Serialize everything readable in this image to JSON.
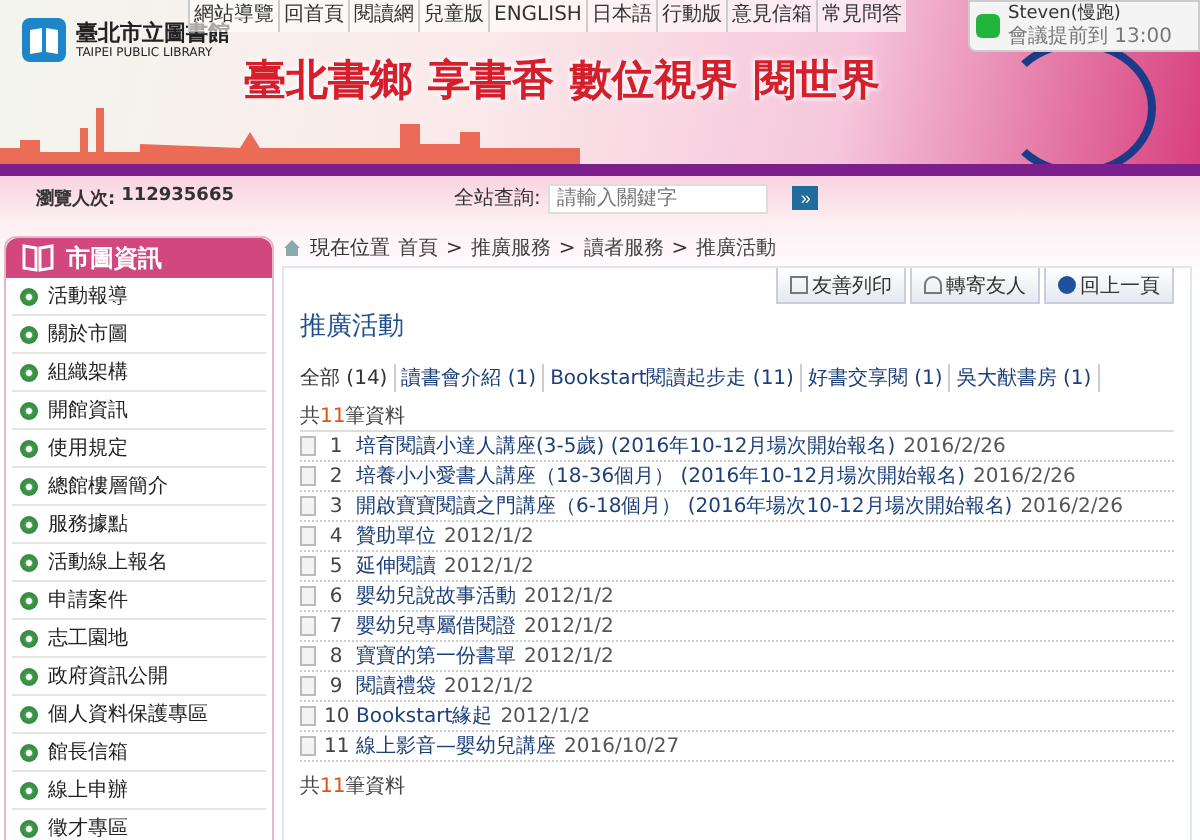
{
  "top_nav": [
    "網站導覽",
    "回首頁",
    "閱讀網",
    "兒童版",
    "ENGLISH",
    "日本語",
    "行動版",
    "意見信箱",
    "常見問答"
  ],
  "logo": {
    "name": "臺北市立圖書館",
    "subtitle": "TAIPEI PUBLIC LIBRARY"
  },
  "banner": {
    "slogans": [
      "臺北書鄉",
      "享書香",
      "數位視界",
      "閱世界"
    ]
  },
  "notification": {
    "sender": "Steven(慢跑)",
    "message": "會議提前到 13:00"
  },
  "visitors": {
    "label": "瀏覽人次:",
    "count": "112935665"
  },
  "search": {
    "label": "全站查詢:",
    "placeholder": "請輸入關鍵字",
    "button": "»"
  },
  "sidebar": {
    "title": "市圖資訊",
    "items": [
      "活動報導",
      "關於市圖",
      "組織架構",
      "開館資訊",
      "使用規定",
      "總館樓層簡介",
      "服務據點",
      "活動線上報名",
      "申請案件",
      "志工園地",
      "政府資訊公開",
      "個人資料保護專區",
      "館長信箱",
      "線上申辦",
      "徵才專區"
    ]
  },
  "breadcrumb": {
    "label": "現在位置",
    "path": [
      {
        "kind": "link",
        "text": "首頁"
      },
      {
        "kind": "separator",
        "text": ">"
      },
      {
        "kind": "link",
        "text": "推廣服務"
      },
      {
        "kind": "separator",
        "text": ">"
      },
      {
        "kind": "link",
        "text": "讀者服務"
      },
      {
        "kind": "separator",
        "text": ">"
      },
      {
        "kind": "link",
        "text": "推廣活動"
      }
    ]
  },
  "actions": [
    {
      "kind": "print",
      "label": "友善列印"
    },
    {
      "kind": "forward",
      "label": "轉寄友人"
    },
    {
      "kind": "back",
      "label": "回上一頁"
    }
  ],
  "page_title": "推廣活動",
  "filters": [
    {
      "label": "全部 (14)",
      "selected": true
    },
    {
      "label": "讀書會介紹 (1)",
      "selected": false
    },
    {
      "label": "Bookstart閱讀起步走 (11)",
      "selected": false
    },
    {
      "label": "好書交享閱 (1)",
      "selected": false
    },
    {
      "label": "吳大猷書房 (1)",
      "selected": false
    }
  ],
  "count_top": {
    "before": "共",
    "number": "11",
    "after": "筆資料"
  },
  "items": [
    {
      "number": "1",
      "title": "培育閱讀小達人講座(3-5歲) (2016年10-12月場次開始報名)",
      "date": "2016/2/26"
    },
    {
      "number": "2",
      "title": "培養小小愛書人講座（18-36個月） (2016年10-12月場次開始報名)",
      "date": "2016/2/26"
    },
    {
      "number": "3",
      "title": "開啟寶寶閱讀之門講座（6-18個月） (2016年場次10-12月場次開始報名)",
      "date": "2016/2/26"
    },
    {
      "number": "4",
      "title": "贊助單位",
      "date": "2012/1/2"
    },
    {
      "number": "5",
      "title": "延伸閱讀",
      "date": "2012/1/2"
    },
    {
      "number": "6",
      "title": "嬰幼兒說故事活動",
      "date": "2012/1/2"
    },
    {
      "number": "7",
      "title": "嬰幼兒專屬借閱證",
      "date": "2012/1/2"
    },
    {
      "number": "8",
      "title": "寶寶的第一份書單",
      "date": "2012/1/2"
    },
    {
      "number": "9",
      "title": "閱讀禮袋",
      "date": "2012/1/2"
    },
    {
      "number": "10",
      "title": "Bookstart緣起",
      "date": "2012/1/2"
    },
    {
      "number": "11",
      "title": "線上影音—嬰幼兒講座",
      "date": "2016/10/27"
    }
  ],
  "count_bottom": {
    "before": "共",
    "number": "11",
    "after": "筆資料"
  }
}
